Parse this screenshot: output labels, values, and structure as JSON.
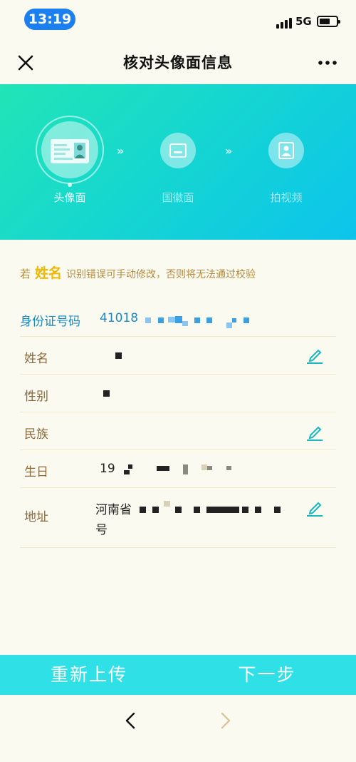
{
  "status_bar": {
    "time": "13:19",
    "network": "5G"
  },
  "nav": {
    "title": "核对头像面信息"
  },
  "steps": [
    {
      "label": "头像面",
      "icon": "id-card-front-icon"
    },
    {
      "label": "国徽面",
      "icon": "id-card-back-icon"
    },
    {
      "label": "拍视频",
      "icon": "portrait-video-icon"
    }
  ],
  "step_separator": "»",
  "hint": {
    "prefix": "若",
    "highlight": "姓名",
    "text": "识别错误可手动修改，否则将无法通过校验"
  },
  "form": {
    "id_number": {
      "label": "身份证号码",
      "value": "41018"
    },
    "name": {
      "label": "姓名"
    },
    "gender": {
      "label": "性别"
    },
    "ethnicity": {
      "label": "民族"
    },
    "birthday": {
      "label": "生日",
      "value": "19"
    },
    "address": {
      "label": "地址",
      "line1": "河南省",
      "line2": "号"
    }
  },
  "actions": {
    "reupload": "重新上传",
    "next": "下一步"
  },
  "colors": {
    "accent": "#1b7ff0",
    "highlight": "#f0b600",
    "action_bar": "#2fe0e6",
    "label": "#8a6a3c",
    "id_blue": "#1a8ac6"
  }
}
